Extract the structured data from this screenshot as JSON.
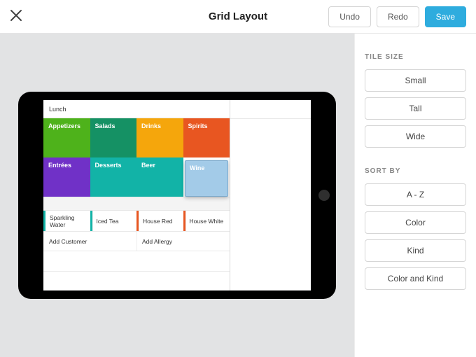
{
  "header": {
    "title": "Grid Layout",
    "undo": "Undo",
    "redo": "Redo",
    "save": "Save"
  },
  "sidebar": {
    "tile_size_heading": "TILE SIZE",
    "tile_sizes": [
      "Small",
      "Tall",
      "Wide"
    ],
    "sort_by_heading": "SORT BY",
    "sort_options": [
      "A - Z",
      "Color",
      "Kind",
      "Color and Kind"
    ]
  },
  "grid": {
    "page_name": "Lunch",
    "categories": [
      {
        "label": "Appetizers",
        "color": "#4eb21b"
      },
      {
        "label": "Salads",
        "color": "#159164"
      },
      {
        "label": "Drinks",
        "color": "#f5a60c"
      },
      {
        "label": "Spirits",
        "color": "#e85621"
      },
      {
        "label": "Entrées",
        "color": "#7031c7"
      },
      {
        "label": "Desserts",
        "color": "#12b3a7"
      },
      {
        "label": "Beer",
        "color": "#12b3a7"
      },
      {
        "label": "Wine",
        "color": "#a3cbe8",
        "selected": true
      }
    ],
    "items": [
      {
        "label": "Sparkling Water",
        "accent": "#12b3a7"
      },
      {
        "label": "Iced Tea",
        "accent": "#12b3a7"
      },
      {
        "label": "House Red",
        "accent": "#e85621"
      },
      {
        "label": "House White",
        "accent": "#e85621"
      }
    ],
    "actions": {
      "add_customer": "Add Customer",
      "add_allergy": "Add Allergy"
    }
  }
}
